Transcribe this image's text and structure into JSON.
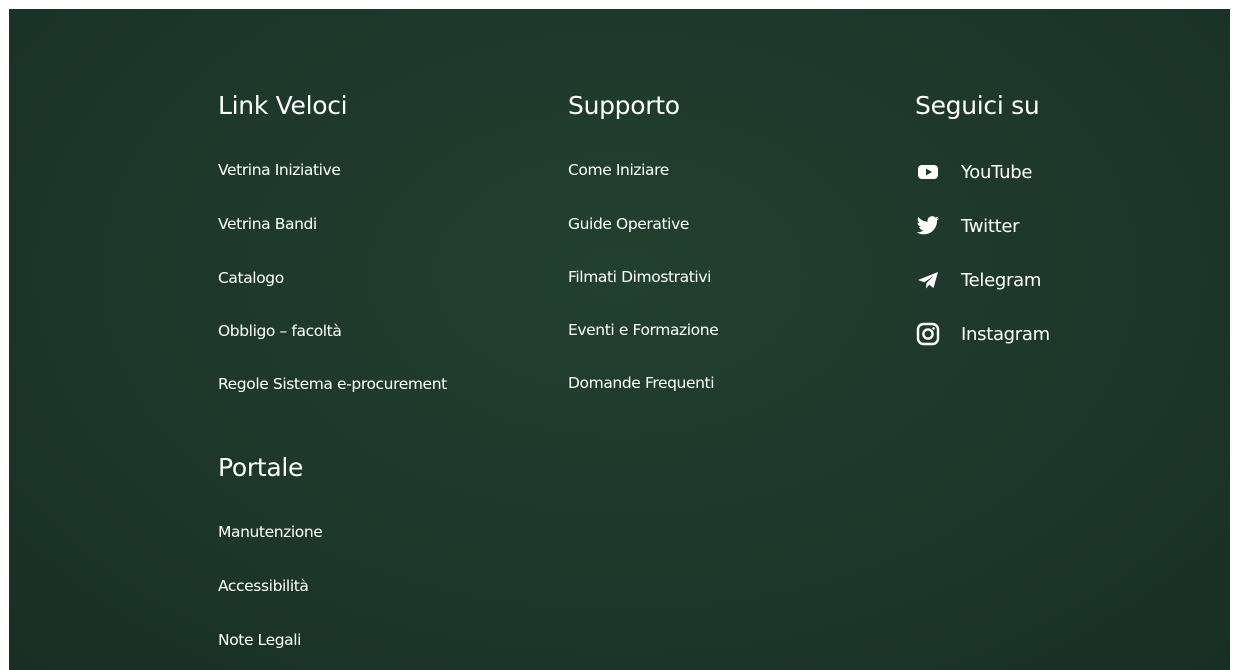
{
  "quick_links": {
    "heading": "Link Veloci",
    "items": [
      {
        "label": "Vetrina Iniziative"
      },
      {
        "label": "Vetrina Bandi"
      },
      {
        "label": "Catalogo"
      },
      {
        "label": "Obbligo – facoltà"
      },
      {
        "label": "Regole Sistema e-procurement"
      }
    ]
  },
  "portal": {
    "heading": "Portale",
    "items": [
      {
        "label": "Manutenzione"
      },
      {
        "label": "Accessibilità"
      },
      {
        "label": "Note Legali"
      }
    ]
  },
  "support": {
    "heading": "Supporto",
    "items": [
      {
        "label": "Come Iniziare"
      },
      {
        "label": "Guide Operative"
      },
      {
        "label": "Filmati Dimostrativi"
      },
      {
        "label": "Eventi e Formazione"
      },
      {
        "label": "Domande Frequenti"
      }
    ]
  },
  "follow": {
    "heading": "Seguici su",
    "items": [
      {
        "label": "YouTube",
        "icon": "youtube-icon"
      },
      {
        "label": "Twitter",
        "icon": "twitter-icon"
      },
      {
        "label": "Telegram",
        "icon": "telegram-icon"
      },
      {
        "label": "Instagram",
        "icon": "instagram-icon"
      }
    ]
  },
  "colors": {
    "background": "#1f3a2e",
    "text": "#ffffff"
  }
}
